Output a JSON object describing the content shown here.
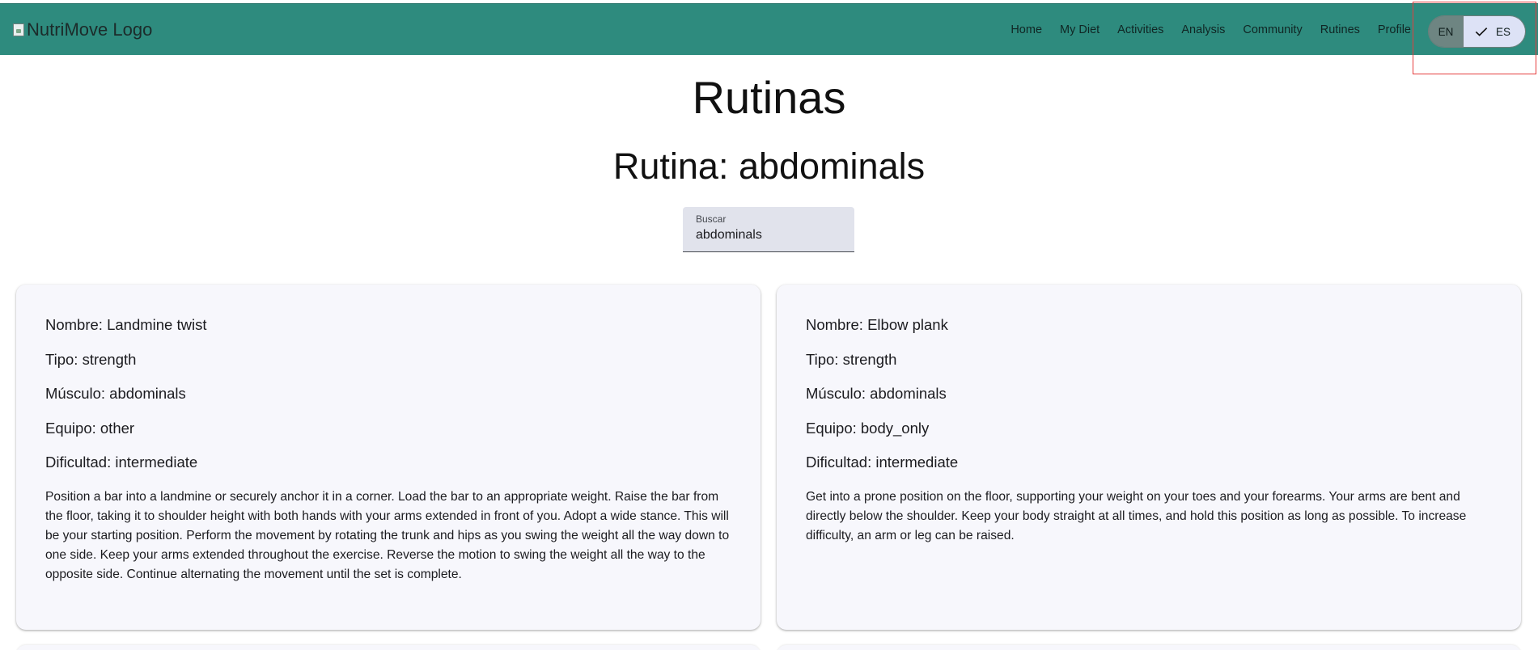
{
  "header": {
    "logo_alt": "NutriMove Logo",
    "nav": [
      {
        "label": "Home"
      },
      {
        "label": "My Diet"
      },
      {
        "label": "Activities"
      },
      {
        "label": "Analysis"
      },
      {
        "label": "Community"
      },
      {
        "label": "Rutines"
      },
      {
        "label": "Profile"
      }
    ],
    "lang": {
      "en": "EN",
      "es": "ES",
      "selected": "ES"
    },
    "colors": {
      "bar": "#2e8b7e",
      "highlight": "#e53e3e"
    }
  },
  "page": {
    "title": "Rutinas",
    "subtitle": "Rutina: abdominals"
  },
  "search": {
    "label": "Buscar",
    "value": "abdominals"
  },
  "cards": [
    {
      "name": "Nombre: Landmine twist",
      "type": "Tipo: strength",
      "muscle": "Músculo: abdominals",
      "equipment": "Equipo: other",
      "difficulty": "Dificultad: intermediate",
      "description": "Position a bar into a landmine or securely anchor it in a corner. Load the bar to an appropriate weight. Raise the bar from the floor, taking it to shoulder height with both hands with your arms extended in front of you. Adopt a wide stance. This will be your starting position. Perform the movement by rotating the trunk and hips as you swing the weight all the way down to one side. Keep your arms extended throughout the exercise. Reverse the motion to swing the weight all the way to the opposite side. Continue alternating the movement until the set is complete."
    },
    {
      "name": "Nombre: Elbow plank",
      "type": "Tipo: strength",
      "muscle": "Músculo: abdominals",
      "equipment": "Equipo: body_only",
      "difficulty": "Dificultad: intermediate",
      "description": "Get into a prone position on the floor, supporting your weight on your toes and your forearms. Your arms are bent and directly below the shoulder. Keep your body straight at all times, and hold this position as long as possible. To increase difficulty, an arm or leg can be raised."
    }
  ]
}
